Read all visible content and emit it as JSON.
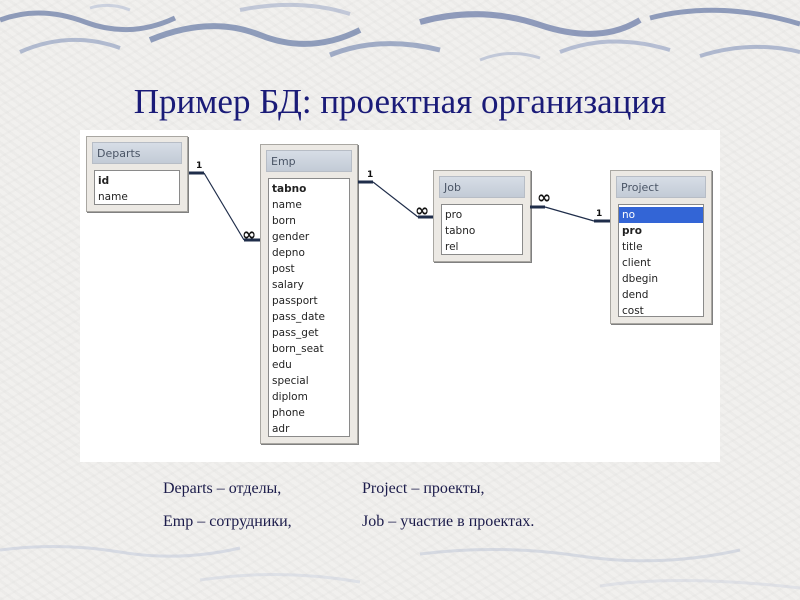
{
  "slide": {
    "title": "Пример БД: проектная организация"
  },
  "tables": {
    "departs": {
      "title": "Departs",
      "fields": [
        "id",
        "name"
      ]
    },
    "emp": {
      "title": "Emp",
      "fields": [
        "tabno",
        "name",
        "born",
        "gender",
        "depno",
        "post",
        "salary",
        "passport",
        "pass_date",
        "pass_get",
        "born_seat",
        "edu",
        "special",
        "diplom",
        "phone",
        "adr"
      ]
    },
    "job": {
      "title": "Job",
      "fields": [
        "pro",
        "tabno",
        "rel"
      ]
    },
    "project": {
      "title": "Project",
      "fields": [
        "no",
        "pro",
        "title",
        "client",
        "dbegin",
        "dend",
        "cost"
      ]
    }
  },
  "relations": {
    "one": "1",
    "many": "∞"
  },
  "legend": {
    "departs": "Departs – отделы,",
    "emp": "Emp – сотрудники,",
    "project": "Project – проекты,",
    "job": "Job – участие в проектах."
  },
  "colors": {
    "title": "#1a1b78",
    "selection": "#3365d6",
    "stroke": "#4a5f8a"
  }
}
